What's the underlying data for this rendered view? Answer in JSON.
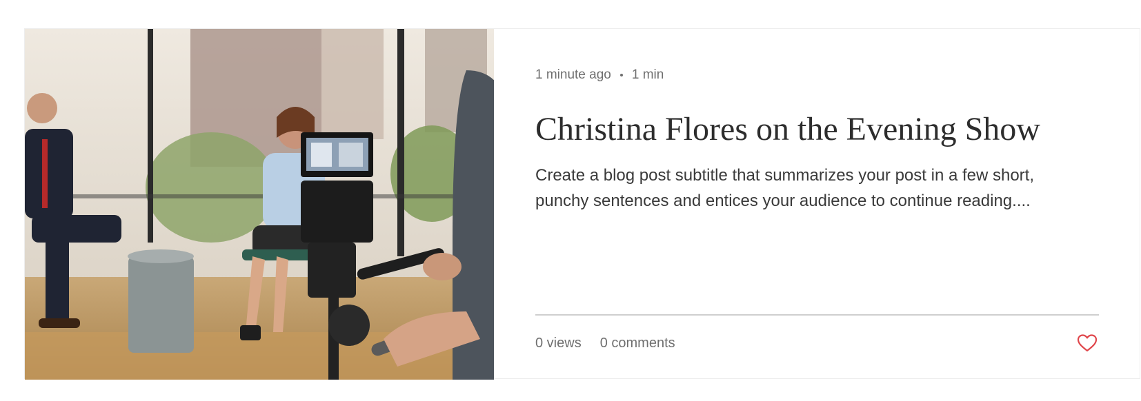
{
  "post": {
    "published": "1 minute ago",
    "read_time": "1 min",
    "title": "Christina Flores on the Evening Show",
    "excerpt": "Create a blog post subtitle that summarizes your post in a few short, punchy sentences and entices your audience to continue reading....",
    "views": "0 views",
    "comments": "0 comments",
    "like_icon": "heart-outline-icon"
  },
  "colors": {
    "like": "#e0474c",
    "divider": "#cfcfcf",
    "meta_text": "#6f6f6f"
  }
}
